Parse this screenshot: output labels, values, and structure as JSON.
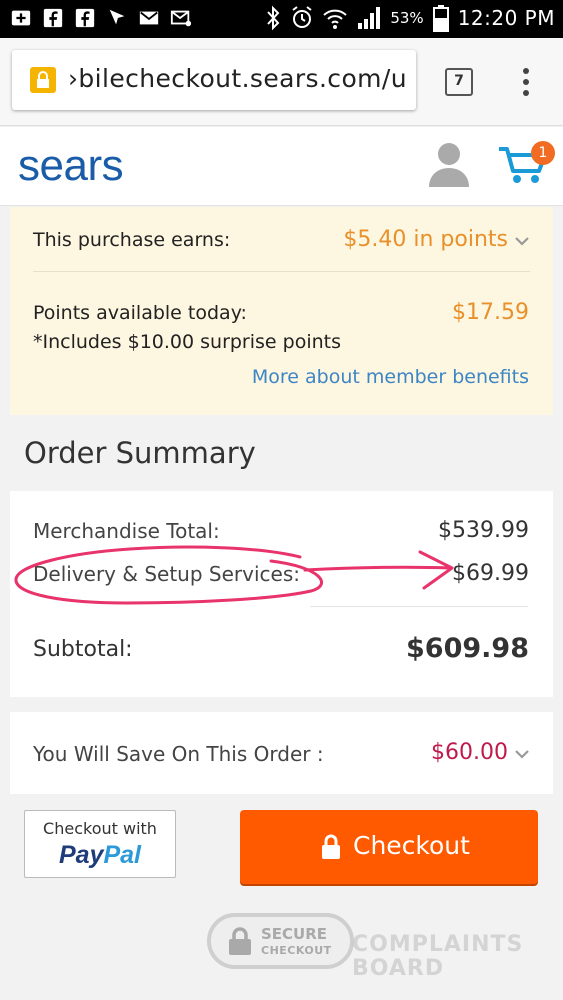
{
  "status_bar": {
    "battery_percent": "53%",
    "time": "12:20 PM",
    "icons": [
      "add-icon",
      "facebook-icon",
      "facebook-icon",
      "navigation-icon",
      "gmail-icon",
      "mail-icon",
      "bluetooth-icon",
      "alarm-icon",
      "wifi-icon",
      "signal-icon",
      "battery-icon"
    ]
  },
  "browser": {
    "url": "›bilecheckout.sears.com/u",
    "tab_count": "7"
  },
  "header": {
    "logo": "sears",
    "cart_count": "1"
  },
  "points": {
    "earn_label": "This purchase earns:",
    "earn_value": "$5.40 in points",
    "available_label": "Points available today:",
    "available_value": "$17.59",
    "note": "*Includes $10.00 surprise points",
    "link": "More about member benefits"
  },
  "order_summary": {
    "title": "Order Summary",
    "rows": [
      {
        "label": "Merchandise Total:",
        "value": "$539.99"
      },
      {
        "label": "Delivery & Setup Services:",
        "value": "$69.99"
      }
    ],
    "subtotal_label": "Subtotal:",
    "subtotal_value": "$609.98"
  },
  "savings": {
    "label": "You Will Save On This Order :",
    "value": "$60.00"
  },
  "buttons": {
    "paypal_top": "Checkout with",
    "paypal_logo_1": "Pay",
    "paypal_logo_2": "Pal",
    "checkout": "Checkout"
  },
  "badges": {
    "secure_1": "SECURE",
    "secure_2": "CHECKOUT",
    "watermark_1": "COMPLAINTS",
    "watermark_2": "BOARD"
  },
  "colors": {
    "brand_blue": "#1a5ca8",
    "points_orange": "#e8902a",
    "checkout_orange": "#ff5a00",
    "savings_red": "#c0194b",
    "annotation_pink": "#e8336b"
  }
}
